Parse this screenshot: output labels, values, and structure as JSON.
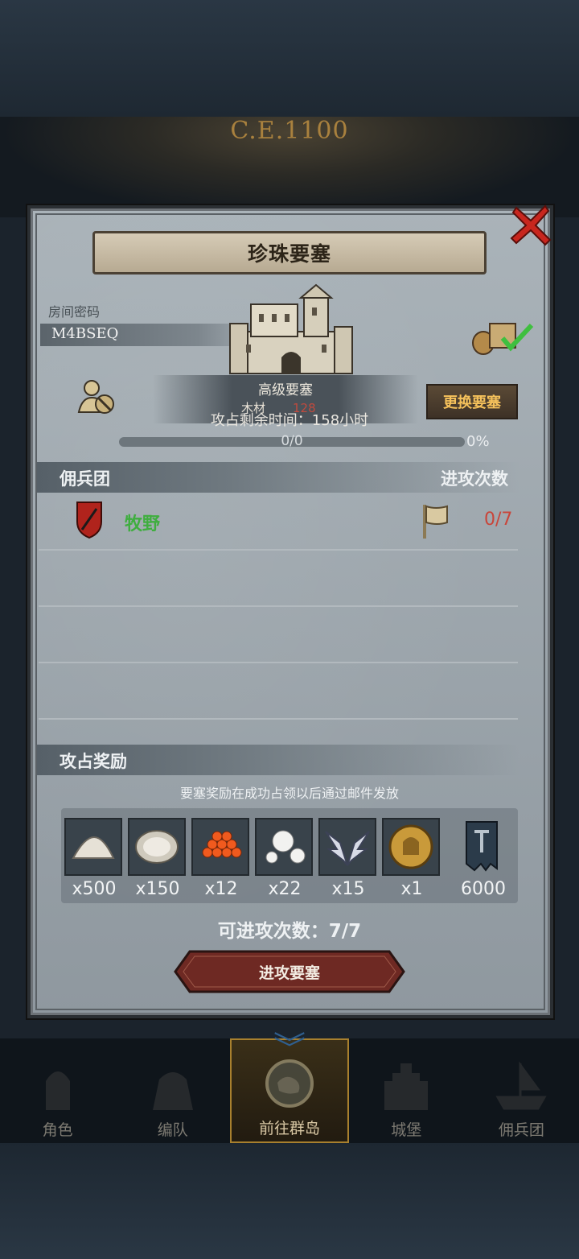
{
  "era_label": "C.E.1100",
  "dialog": {
    "title": "珍珠要塞",
    "room_label": "房间密码",
    "room_code": "M4BSEQ",
    "fortress_level": "高级要塞",
    "resource_label": "木材",
    "resource_value": "128",
    "remaining_time": "攻占剩余时间：158小时",
    "swap_button": "更换要塞",
    "progress_text": "0/0",
    "progress_percent": "0%",
    "progress_value": 0
  },
  "mercenary": {
    "header": "佣兵团",
    "attacks_header": "进攻次数",
    "rows": [
      {
        "name": "牧野",
        "attacks": "0/7"
      }
    ]
  },
  "rewards": {
    "header": "攻占奖励",
    "note": "要塞奖励在成功占领以后通过邮件发放",
    "items": [
      {
        "icon": "salt-pile-icon",
        "count": "x500"
      },
      {
        "icon": "oyster-icon",
        "count": "x150"
      },
      {
        "icon": "roe-icon",
        "count": "x12"
      },
      {
        "icon": "pearl-icon",
        "count": "x22"
      },
      {
        "icon": "wing-emblem-icon",
        "count": "x15"
      },
      {
        "icon": "gold-helmet-coin-icon",
        "count": "x1"
      },
      {
        "icon": "banner-icon",
        "count": "6000"
      }
    ]
  },
  "available_attacks": "可进攻次数：7/7",
  "attack_button": "进攻要塞",
  "nav": {
    "items": [
      {
        "label": "角色"
      },
      {
        "label": "编队"
      },
      {
        "label": "前往群岛"
      },
      {
        "label": "城堡"
      },
      {
        "label": "佣兵团"
      }
    ]
  },
  "colors": {
    "accent_gold": "#f5c15b",
    "merc_green": "#3fae3f",
    "attack_red": "#c9453a",
    "button_red": "#7a2a24"
  }
}
